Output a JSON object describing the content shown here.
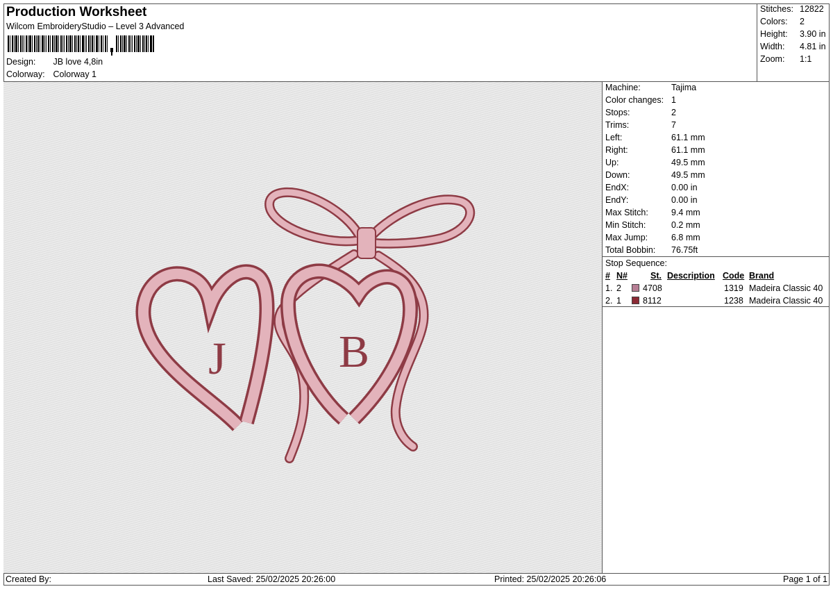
{
  "header": {
    "title": "Production Worksheet",
    "subtitle": "Wilcom EmbroideryStudio – Level 3 Advanced",
    "design_label": "Design:",
    "design_value": "JB love 4,8in",
    "colorway_label": "Colorway:",
    "colorway_value": "Colorway 1"
  },
  "summary": {
    "stitches_label": "Stitches:",
    "stitches_value": "12822",
    "colors_label": "Colors:",
    "colors_value": "2",
    "height_label": "Height:",
    "height_value": "3.90 in",
    "width_label": "Width:",
    "width_value": "4.81 in",
    "zoom_label": "Zoom:",
    "zoom_value": "1:1"
  },
  "preview": {
    "monogram_left": "J",
    "monogram_right": "B",
    "thread_light": "#e3b3bb",
    "thread_dark": "#8e3b45",
    "background": "#e7e7e7"
  },
  "machine": [
    {
      "label": "Machine:",
      "value": "Tajima"
    },
    {
      "label": "Color changes:",
      "value": "1"
    },
    {
      "label": "Stops:",
      "value": "2"
    },
    {
      "label": "Trims:",
      "value": "7"
    },
    {
      "label": "Left:",
      "value": "61.1 mm"
    },
    {
      "label": "Right:",
      "value": "61.1 mm"
    },
    {
      "label": "Up:",
      "value": "49.5 mm"
    },
    {
      "label": "Down:",
      "value": "49.5 mm"
    },
    {
      "label": "EndX:",
      "value": "0.00 in"
    },
    {
      "label": "EndY:",
      "value": "0.00 in"
    },
    {
      "label": "Max Stitch:",
      "value": "9.4 mm"
    },
    {
      "label": "Min Stitch:",
      "value": "0.2 mm"
    },
    {
      "label": "Max Jump:",
      "value": "6.8 mm"
    },
    {
      "label": "Total Bobbin:",
      "value": "76.75ft"
    }
  ],
  "stop_sequence": {
    "title": "Stop Sequence:",
    "headers": {
      "num": "#",
      "n": "N#",
      "st": "St.",
      "description": "Description",
      "code": "Code",
      "brand": "Brand"
    },
    "rows": [
      {
        "num": "1.",
        "n": "2",
        "color": "#b77f95",
        "st": "4708",
        "code": "1319",
        "brand": "Madeira Classic 40"
      },
      {
        "num": "2.",
        "n": "1",
        "color": "#8b2a35",
        "st": "8112",
        "code": "1238",
        "brand": "Madeira Classic 40"
      }
    ]
  },
  "footer": {
    "created_by": "Created By:",
    "last_saved": "Last Saved: 25/02/2025 20:26:00",
    "printed": "Printed: 25/02/2025 20:26:06",
    "page": "Page 1 of 1"
  }
}
